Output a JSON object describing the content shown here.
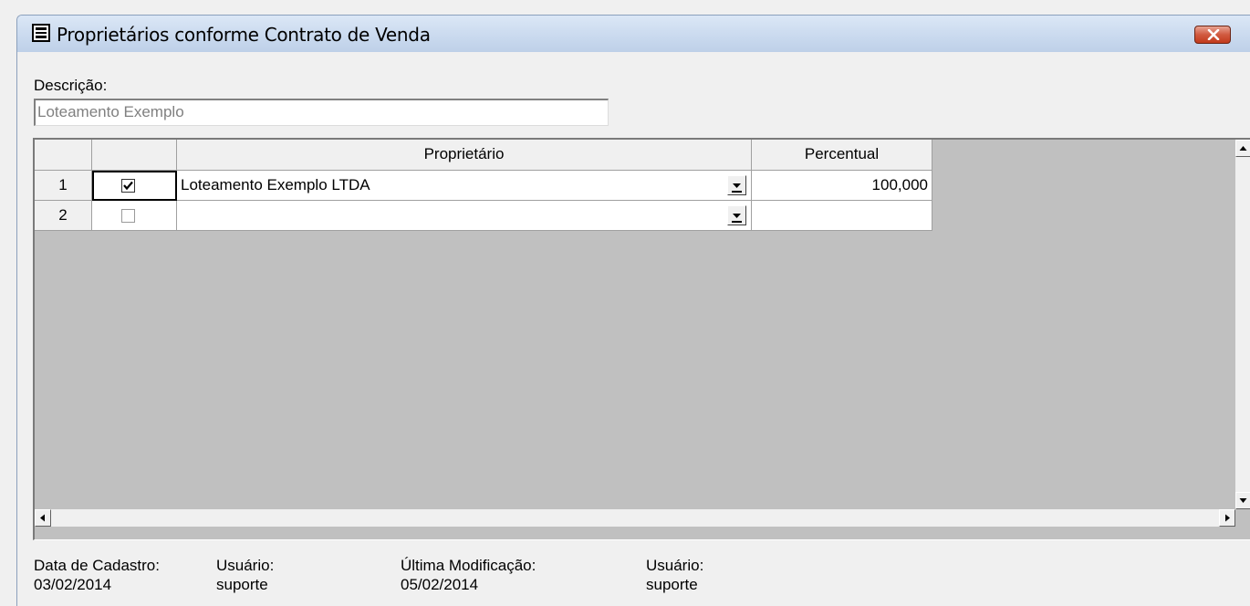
{
  "window": {
    "title": "Proprietários conforme Contrato de Venda",
    "close_icon": "close-x-icon"
  },
  "descricao": {
    "label": "Descrição:",
    "value": "Loteamento Exemplo"
  },
  "grid": {
    "columns": [
      "",
      "",
      "Proprietário",
      "Percentual"
    ],
    "rows": [
      {
        "num": "1",
        "checked": true,
        "proprietario": "Loteamento Exemplo LTDA",
        "percentual": "100,000"
      },
      {
        "num": "2",
        "checked": false,
        "proprietario": "",
        "percentual": ""
      }
    ]
  },
  "footer": {
    "data_cadastro_label": "Data de Cadastro:",
    "data_cadastro": "03/02/2014",
    "usuario_label": "Usuário:",
    "usuario": "suporte",
    "ultima_modificacao_label": "Última Modificação:",
    "ultima_modificacao": "05/02/2014",
    "usuario2_label": "Usuário:",
    "usuario2": "suporte"
  },
  "colors": {
    "titlebar": "#c9d9ee",
    "close_button": "#d15a40",
    "grid_background": "#c0c0c0"
  }
}
